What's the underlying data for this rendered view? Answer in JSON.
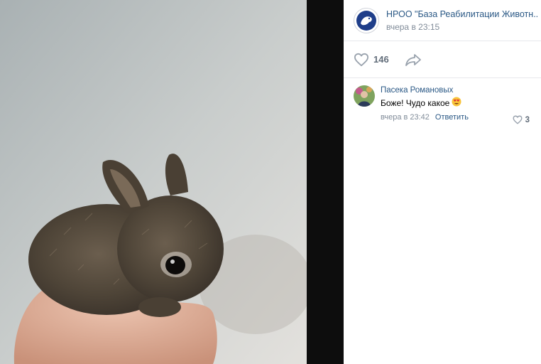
{
  "photo": {
    "subject": "bunny"
  },
  "post": {
    "group_name": "НРОО \"База Реабилитации Животн...",
    "time": "вчера в 23:15",
    "likes": "146"
  },
  "comment": {
    "author": "Пасека Романовых",
    "text": "Боже! Чудо какое",
    "time": "вчера в 23:42",
    "reply_label": "Ответить",
    "likes": "3"
  },
  "colors": {
    "link": "#2a5885",
    "muted": "#818c99",
    "panel_bg": "#ffffff",
    "viewer_bg": "#0f0f0f"
  },
  "icons": [
    "group-logo-icon",
    "heart-icon",
    "share-arrow-icon",
    "heart-eyes-emoji-icon"
  ]
}
